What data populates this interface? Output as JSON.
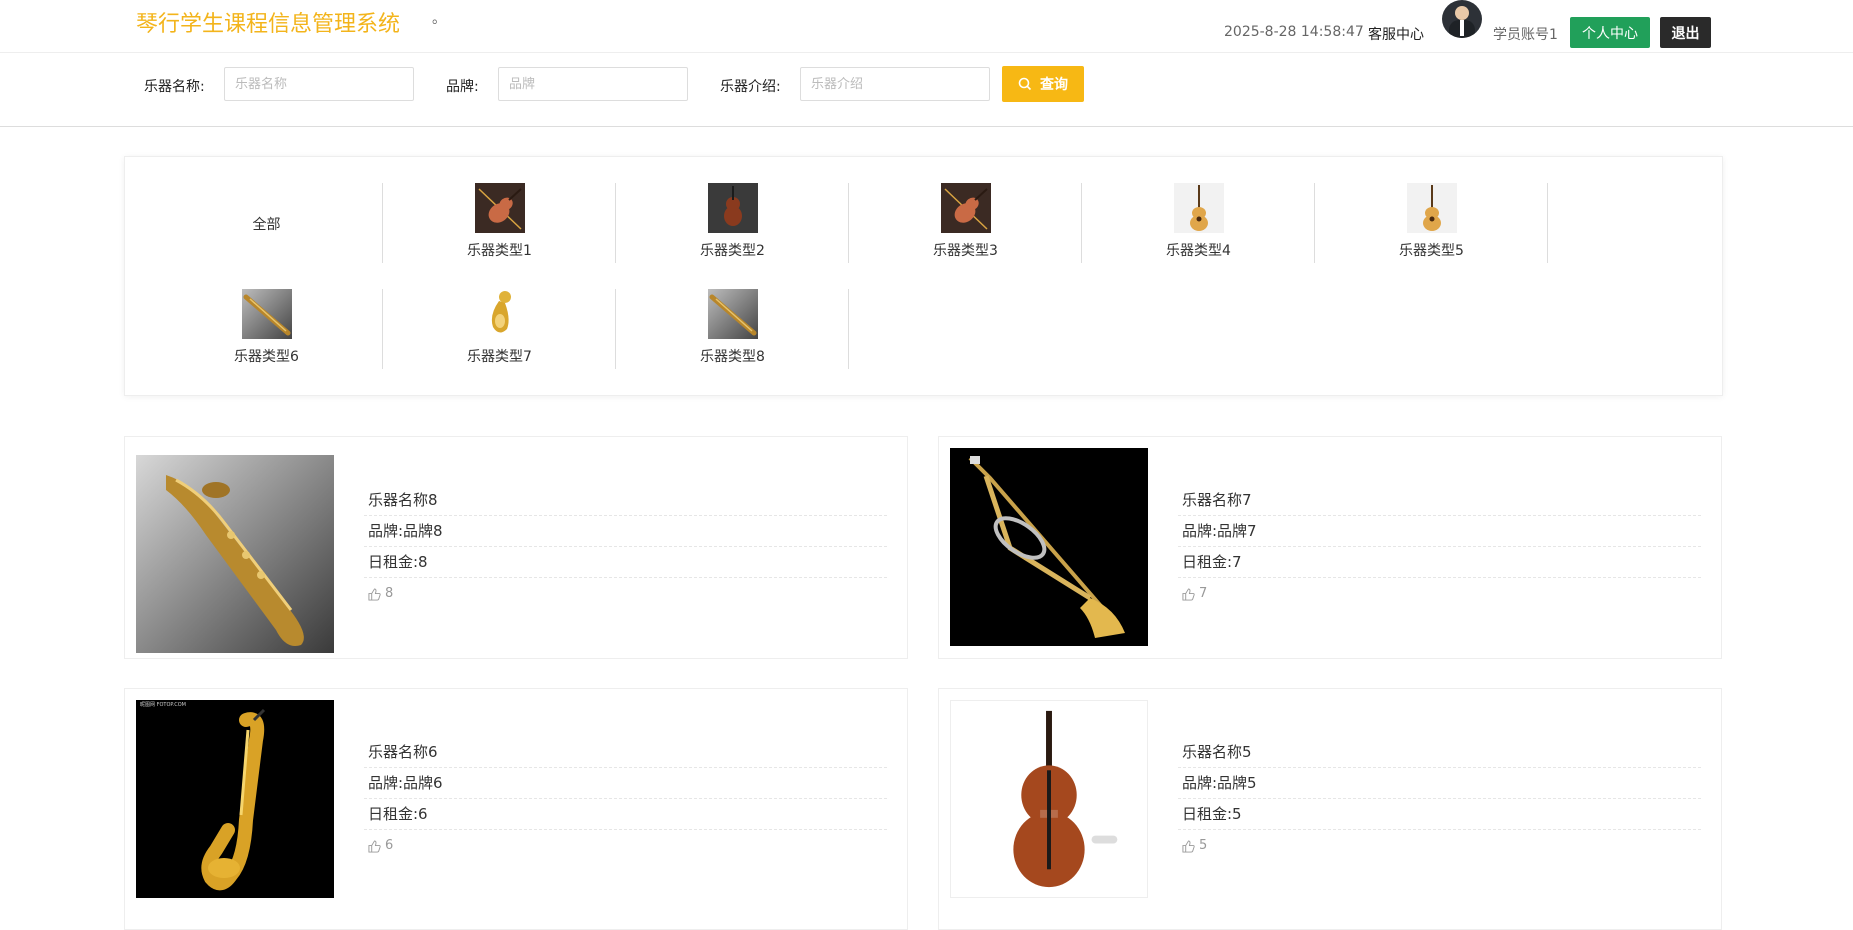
{
  "header": {
    "title": "琴行学生课程信息管理系统",
    "dot": "。",
    "datetime": "2025-8-28 14:58:47",
    "service_center": "客服中心",
    "account": "学员账号1",
    "personal_center": "个人中心",
    "logout": "退出"
  },
  "search": {
    "name_label": "乐器名称:",
    "name_placeholder": "乐器名称",
    "brand_label": "品牌:",
    "brand_placeholder": "品牌",
    "intro_label": "乐器介绍:",
    "intro_placeholder": "乐器介绍",
    "query_button": "查询"
  },
  "categories": [
    {
      "label": "全部"
    },
    {
      "label": "乐器类型1",
      "icon": "violin-icon"
    },
    {
      "label": "乐器类型2",
      "icon": "violin-icon"
    },
    {
      "label": "乐器类型3",
      "icon": "violin-icon"
    },
    {
      "label": "乐器类型4",
      "icon": "guitar-icon"
    },
    {
      "label": "乐器类型5",
      "icon": "guitar-icon"
    },
    {
      "label": "乐器类型6",
      "icon": "saxophone-icon"
    },
    {
      "label": "乐器类型7",
      "icon": "tuba-icon"
    },
    {
      "label": "乐器类型8",
      "icon": "saxophone-icon"
    }
  ],
  "products": [
    {
      "name": "乐器名称8",
      "brand": "品牌:品牌8",
      "rent": "日租金:8",
      "likes": "8",
      "image": "baritone-saxophone"
    },
    {
      "name": "乐器名称7",
      "brand": "品牌:品牌7",
      "rent": "日租金:7",
      "likes": "7",
      "image": "trombone"
    },
    {
      "name": "乐器名称6",
      "brand": "品牌:品牌6",
      "rent": "日租金:6",
      "likes": "6",
      "image": "alto-saxophone",
      "watermark": "昵图网 FOTOP.COM"
    },
    {
      "name": "乐器名称5",
      "brand": "品牌:品牌5",
      "rent": "日租金:5",
      "likes": "5",
      "image": "cello"
    }
  ],
  "colors": {
    "accent": "#f7b814",
    "title": "#f3b41b",
    "personal_button": "#21a05a",
    "logout_button": "#2a2a2a"
  }
}
